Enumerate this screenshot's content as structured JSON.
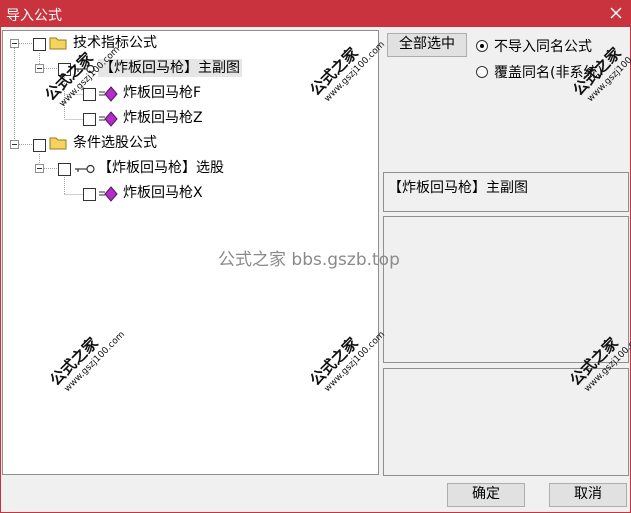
{
  "window": {
    "title": "导入公式"
  },
  "tree": {
    "nodes": [
      {
        "label": "技术指标公式",
        "icon": "folder-icon"
      },
      {
        "label": "【炸板回马枪】主副图",
        "icon": "key-icon"
      },
      {
        "label": "炸板回马枪F",
        "icon": "formula-icon"
      },
      {
        "label": "炸板回马枪Z",
        "icon": "formula-icon"
      },
      {
        "label": "条件选股公式",
        "icon": "folder-icon"
      },
      {
        "label": "【炸板回马枪】选股",
        "icon": "key-icon"
      },
      {
        "label": "炸板回马枪X",
        "icon": "formula-icon"
      }
    ]
  },
  "options": {
    "select_all_label": "全部选中",
    "radio_skip_label": "不导入同名公式",
    "radio_overwrite_label": "覆盖同名(非系统)",
    "selected": "skip"
  },
  "detail": {
    "selected_name": "【炸板回马枪】主副图"
  },
  "footer": {
    "ok_label": "确定",
    "cancel_label": "取消"
  },
  "watermark": {
    "center_text": "公式之家 bbs.gszb.top",
    "stamp_text": "公式之家",
    "stamp_url": "www.gszj100.com"
  },
  "colors": {
    "titlebar": "#c8333d",
    "folder": "#f4d35e",
    "formula": "#b02fc7"
  }
}
